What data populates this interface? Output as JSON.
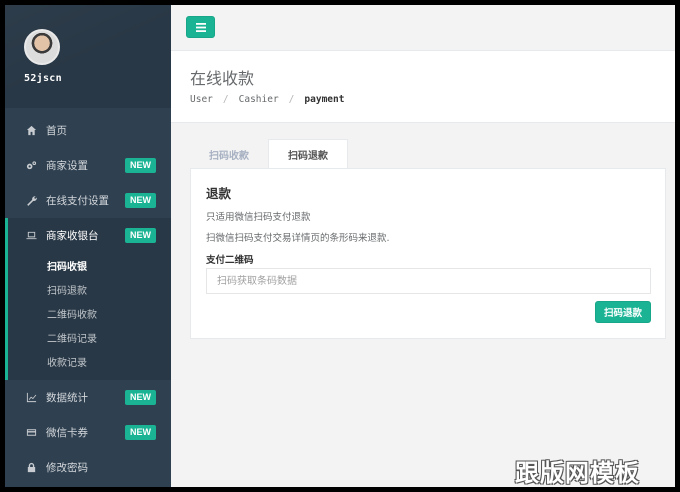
{
  "user": {
    "name": "52jscn"
  },
  "sidebar": {
    "items": [
      {
        "label": "首页",
        "icon": "home-icon"
      },
      {
        "label": "商家设置",
        "icon": "cogs-icon",
        "badge": "NEW"
      },
      {
        "label": "在线支付设置",
        "icon": "wrench-icon",
        "badge": "NEW"
      },
      {
        "label": "商家收银台",
        "icon": "laptop-icon",
        "badge": "NEW",
        "children": [
          "扫码收银",
          "扫码退款",
          "二维码收款",
          "二维码记录",
          "收款记录"
        ]
      },
      {
        "label": "数据统计",
        "icon": "line-chart-icon",
        "badge": "NEW"
      },
      {
        "label": "微信卡券",
        "icon": "credit-card-icon",
        "badge": "NEW"
      },
      {
        "label": "修改密码",
        "icon": "lock-icon"
      }
    ]
  },
  "header": {
    "title": "在线收款",
    "breadcrumb": [
      "User",
      "Cashier",
      "payment"
    ]
  },
  "tabs": [
    "扫码收款",
    "扫码退款"
  ],
  "panel": {
    "title": "退款",
    "line1": "只适用微信扫码支付退款",
    "line2": "扫微信扫码支付交易详情页的条形码来退款.",
    "field_label": "支付二维码",
    "input_placeholder": "扫码获取条码数据",
    "button": "扫码退款"
  },
  "watermark": "跟版网模板",
  "colors": {
    "accent": "#1ab394",
    "sidebar": "#2f4050"
  }
}
